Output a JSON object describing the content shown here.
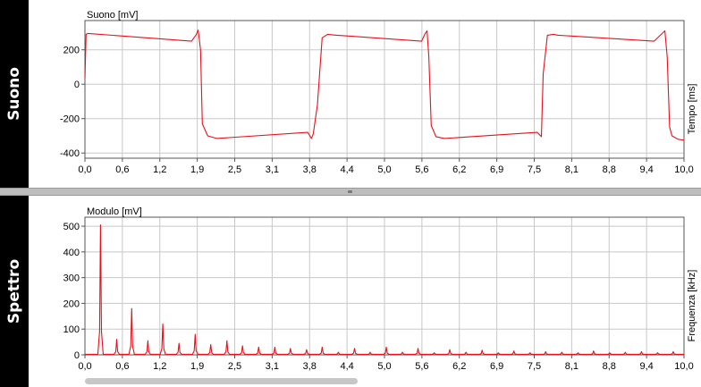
{
  "colors": {
    "signal": "#e8101c",
    "grid": "#c8c8c8",
    "frame": "#555555",
    "panel_label_bg": "#000000"
  },
  "panels": {
    "top": {
      "side_label": "Suono"
    },
    "bottom": {
      "side_label": "Spettro"
    }
  },
  "chart_data": [
    {
      "type": "line",
      "title": "",
      "ylabel": "Suono [mV]",
      "xlabel": "Tempo [ms]",
      "xlim": [
        0,
        10
      ],
      "ylim": [
        -430,
        370
      ],
      "x_ticks": [
        "0,0",
        "0,6",
        "1,2",
        "1,9",
        "2,5",
        "3,1",
        "3,8",
        "4,4",
        "5,0",
        "5,6",
        "6,2",
        "6,9",
        "7,5",
        "8,1",
        "8,8",
        "9,4",
        "10,0"
      ],
      "y_ticks": [
        {
          "v": 200,
          "label": "200"
        },
        {
          "v": 0,
          "label": "0"
        },
        {
          "v": -200,
          "label": "-200"
        },
        {
          "v": -400,
          "label": "-400"
        }
      ],
      "series": [
        {
          "x": [
            0,
            0.02,
            0.05,
            1.78,
            1.86,
            1.89,
            1.93,
            1.96,
            2.05,
            2.2,
            3.72,
            3.78,
            3.81,
            3.88,
            3.96,
            4.05,
            4.2,
            5.62,
            5.68,
            5.71,
            5.74,
            5.78,
            5.86,
            6.0,
            7.55,
            7.62,
            7.65,
            7.72,
            7.82,
            7.9,
            9.5,
            9.68,
            9.72,
            9.76,
            9.8,
            9.9,
            10.0
          ],
          "y": [
            35,
            290,
            295,
            250,
            290,
            315,
            200,
            -230,
            -300,
            -315,
            -280,
            -315,
            -290,
            -120,
            270,
            290,
            285,
            250,
            295,
            310,
            160,
            -240,
            -305,
            -315,
            -280,
            -305,
            60,
            285,
            290,
            285,
            250,
            310,
            160,
            -250,
            -300,
            -320,
            -325
          ]
        }
      ]
    },
    {
      "type": "line",
      "title": "",
      "ylabel": "Modulo [mV]",
      "xlabel": "Frequenza [kHz]",
      "xlim": [
        0,
        10
      ],
      "ylim": [
        0,
        535
      ],
      "x_ticks": [
        "0,0",
        "0,6",
        "1,2",
        "1,9",
        "2,5",
        "3,1",
        "3,8",
        "4,4",
        "5,0",
        "5,6",
        "6,2",
        "6,9",
        "7,5",
        "8,1",
        "8,8",
        "9,4",
        "10,0"
      ],
      "y_ticks": [
        {
          "v": 500,
          "label": "500"
        },
        {
          "v": 400,
          "label": "400"
        },
        {
          "v": 300,
          "label": "300"
        },
        {
          "v": 200,
          "label": "200"
        },
        {
          "v": 100,
          "label": "100"
        },
        {
          "v": 0,
          "label": "0"
        }
      ],
      "series": [
        {
          "peaks": [
            [
              0.26,
              505
            ],
            [
              0.53,
              60
            ],
            [
              0.78,
              180
            ],
            [
              1.05,
              55
            ],
            [
              1.3,
              120
            ],
            [
              1.57,
              45
            ],
            [
              1.84,
              80
            ],
            [
              2.1,
              40
            ],
            [
              2.37,
              55
            ],
            [
              2.63,
              35
            ],
            [
              2.9,
              30
            ],
            [
              3.17,
              30
            ],
            [
              3.43,
              25
            ],
            [
              3.7,
              20
            ],
            [
              3.96,
              30
            ],
            [
              4.23,
              10
            ],
            [
              4.5,
              25
            ],
            [
              4.76,
              10
            ],
            [
              5.03,
              30
            ],
            [
              5.3,
              10
            ],
            [
              5.56,
              25
            ],
            [
              5.83,
              8
            ],
            [
              6.09,
              20
            ],
            [
              6.36,
              10
            ],
            [
              6.63,
              18
            ],
            [
              6.9,
              8
            ],
            [
              7.16,
              15
            ],
            [
              7.43,
              8
            ],
            [
              7.69,
              12
            ],
            [
              7.96,
              10
            ],
            [
              8.23,
              8
            ],
            [
              8.49,
              15
            ],
            [
              8.76,
              8
            ],
            [
              9.02,
              10
            ],
            [
              9.29,
              12
            ],
            [
              9.56,
              8
            ],
            [
              9.82,
              12
            ]
          ]
        }
      ]
    }
  ]
}
